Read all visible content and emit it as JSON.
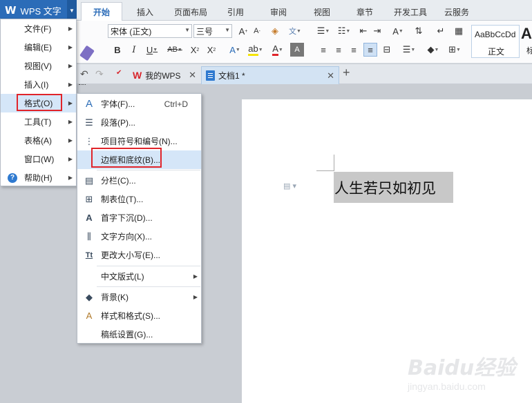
{
  "app": {
    "logo": "W",
    "name": "WPS 文字"
  },
  "ribbon_tabs": [
    "开始",
    "插入",
    "页面布局",
    "引用",
    "审阅",
    "视图",
    "章节",
    "开发工具",
    "云服务"
  ],
  "active_tab": "开始",
  "ribbon": {
    "format_painter_label": "格式刷",
    "font_name": "宋体 (正文)",
    "font_size": "三号",
    "style_sample": "AaBbCcDd",
    "style_label": "正文",
    "style_big_sample": "A",
    "style_big_label": "标"
  },
  "doc_tabs": [
    {
      "label": "我的WPS"
    },
    {
      "label": "文档1 *"
    }
  ],
  "main_menu": [
    {
      "label": "文件(F)"
    },
    {
      "label": "编辑(E)"
    },
    {
      "label": "视图(V)"
    },
    {
      "label": "插入(I)"
    },
    {
      "label": "格式(O)"
    },
    {
      "label": "工具(T)"
    },
    {
      "label": "表格(A)"
    },
    {
      "label": "窗口(W)"
    },
    {
      "label": "帮助(H)"
    }
  ],
  "format_submenu": [
    {
      "label": "字体(F)...",
      "shortcut": "Ctrl+D",
      "icon": "font-icon"
    },
    {
      "label": "段落(P)...",
      "icon": "paragraph-icon"
    },
    {
      "label": "项目符号和编号(N)...",
      "icon": "bullet-list-icon"
    },
    {
      "label": "边框和底纹(B)...",
      "icon": ""
    },
    {
      "label": "分栏(C)...",
      "icon": "columns-icon"
    },
    {
      "label": "制表位(T)...",
      "icon": "tab-stop-icon"
    },
    {
      "label": "首字下沉(D)...",
      "icon": "drop-cap-icon"
    },
    {
      "label": "文字方向(X)...",
      "icon": "text-direction-icon"
    },
    {
      "label": "更改大小写(E)...",
      "icon": "change-case-icon"
    },
    {
      "label": "中文版式(L)",
      "icon": ""
    },
    {
      "label": "背景(K)",
      "icon": "paint-bucket-icon"
    },
    {
      "label": "样式和格式(S)...",
      "icon": "styles-icon"
    },
    {
      "label": "稿纸设置(G)...",
      "icon": ""
    }
  ],
  "document": {
    "selected_text": "人生若只如初见"
  },
  "watermark": {
    "brand": "Baidu经验",
    "url": "jingyan.baidu.com"
  },
  "colors": {
    "accent": "#2b6cb8",
    "highlight": "#e0242a",
    "selection": "#c8c8c8"
  }
}
